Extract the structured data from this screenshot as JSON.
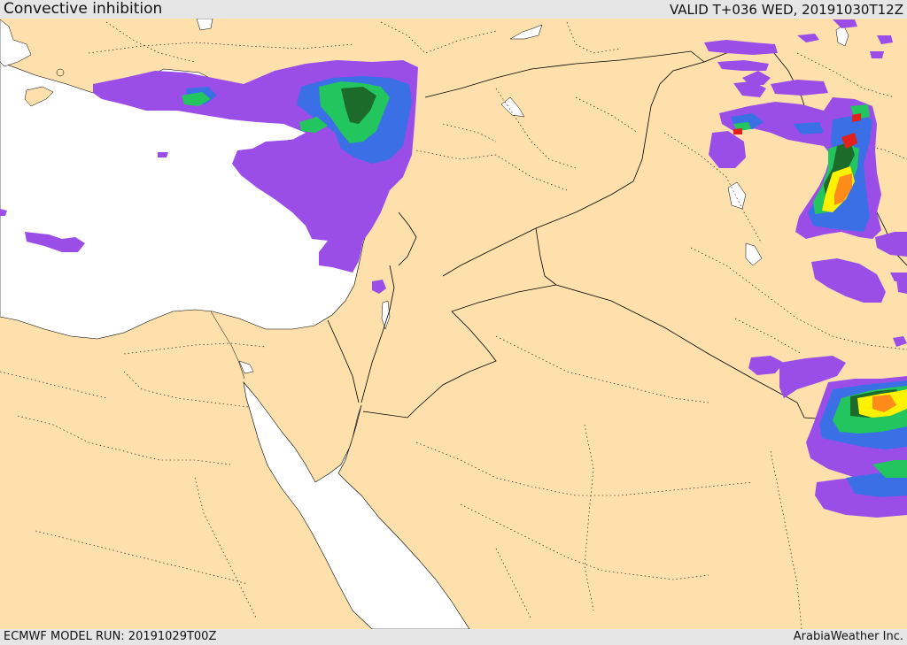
{
  "header": {
    "title": "Convective inhibition",
    "valid": "VALID T+036 WED, 20191030T12Z"
  },
  "footer": {
    "model_run": "ECMWF MODEL RUN: 20191029T00Z",
    "brand": "ArabiaWeather Inc."
  },
  "map": {
    "land_color": "#fde0ac",
    "sea_color": "#ffffff",
    "border_color": "#000000",
    "palette": {
      "purple": "#9b4de8",
      "blue": "#3b6fe6",
      "green": "#22c55e",
      "darkgreen": "#1d6b2a",
      "yellow": "#fff200",
      "orange": "#ff8c1a",
      "red": "#e3211c"
    }
  }
}
